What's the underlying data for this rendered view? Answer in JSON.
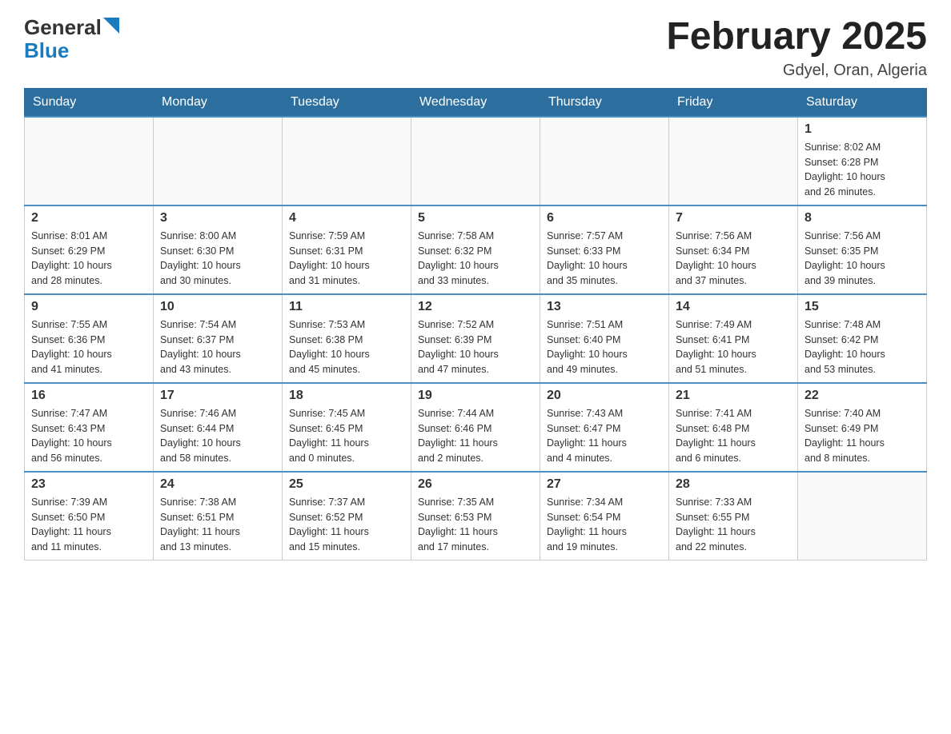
{
  "header": {
    "title": "February 2025",
    "subtitle": "Gdyel, Oran, Algeria",
    "logo_general": "General",
    "logo_blue": "Blue"
  },
  "days_of_week": [
    "Sunday",
    "Monday",
    "Tuesday",
    "Wednesday",
    "Thursday",
    "Friday",
    "Saturday"
  ],
  "weeks": [
    [
      {
        "day": "",
        "info": ""
      },
      {
        "day": "",
        "info": ""
      },
      {
        "day": "",
        "info": ""
      },
      {
        "day": "",
        "info": ""
      },
      {
        "day": "",
        "info": ""
      },
      {
        "day": "",
        "info": ""
      },
      {
        "day": "1",
        "info": "Sunrise: 8:02 AM\nSunset: 6:28 PM\nDaylight: 10 hours\nand 26 minutes."
      }
    ],
    [
      {
        "day": "2",
        "info": "Sunrise: 8:01 AM\nSunset: 6:29 PM\nDaylight: 10 hours\nand 28 minutes."
      },
      {
        "day": "3",
        "info": "Sunrise: 8:00 AM\nSunset: 6:30 PM\nDaylight: 10 hours\nand 30 minutes."
      },
      {
        "day": "4",
        "info": "Sunrise: 7:59 AM\nSunset: 6:31 PM\nDaylight: 10 hours\nand 31 minutes."
      },
      {
        "day": "5",
        "info": "Sunrise: 7:58 AM\nSunset: 6:32 PM\nDaylight: 10 hours\nand 33 minutes."
      },
      {
        "day": "6",
        "info": "Sunrise: 7:57 AM\nSunset: 6:33 PM\nDaylight: 10 hours\nand 35 minutes."
      },
      {
        "day": "7",
        "info": "Sunrise: 7:56 AM\nSunset: 6:34 PM\nDaylight: 10 hours\nand 37 minutes."
      },
      {
        "day": "8",
        "info": "Sunrise: 7:56 AM\nSunset: 6:35 PM\nDaylight: 10 hours\nand 39 minutes."
      }
    ],
    [
      {
        "day": "9",
        "info": "Sunrise: 7:55 AM\nSunset: 6:36 PM\nDaylight: 10 hours\nand 41 minutes."
      },
      {
        "day": "10",
        "info": "Sunrise: 7:54 AM\nSunset: 6:37 PM\nDaylight: 10 hours\nand 43 minutes."
      },
      {
        "day": "11",
        "info": "Sunrise: 7:53 AM\nSunset: 6:38 PM\nDaylight: 10 hours\nand 45 minutes."
      },
      {
        "day": "12",
        "info": "Sunrise: 7:52 AM\nSunset: 6:39 PM\nDaylight: 10 hours\nand 47 minutes."
      },
      {
        "day": "13",
        "info": "Sunrise: 7:51 AM\nSunset: 6:40 PM\nDaylight: 10 hours\nand 49 minutes."
      },
      {
        "day": "14",
        "info": "Sunrise: 7:49 AM\nSunset: 6:41 PM\nDaylight: 10 hours\nand 51 minutes."
      },
      {
        "day": "15",
        "info": "Sunrise: 7:48 AM\nSunset: 6:42 PM\nDaylight: 10 hours\nand 53 minutes."
      }
    ],
    [
      {
        "day": "16",
        "info": "Sunrise: 7:47 AM\nSunset: 6:43 PM\nDaylight: 10 hours\nand 56 minutes."
      },
      {
        "day": "17",
        "info": "Sunrise: 7:46 AM\nSunset: 6:44 PM\nDaylight: 10 hours\nand 58 minutes."
      },
      {
        "day": "18",
        "info": "Sunrise: 7:45 AM\nSunset: 6:45 PM\nDaylight: 11 hours\nand 0 minutes."
      },
      {
        "day": "19",
        "info": "Sunrise: 7:44 AM\nSunset: 6:46 PM\nDaylight: 11 hours\nand 2 minutes."
      },
      {
        "day": "20",
        "info": "Sunrise: 7:43 AM\nSunset: 6:47 PM\nDaylight: 11 hours\nand 4 minutes."
      },
      {
        "day": "21",
        "info": "Sunrise: 7:41 AM\nSunset: 6:48 PM\nDaylight: 11 hours\nand 6 minutes."
      },
      {
        "day": "22",
        "info": "Sunrise: 7:40 AM\nSunset: 6:49 PM\nDaylight: 11 hours\nand 8 minutes."
      }
    ],
    [
      {
        "day": "23",
        "info": "Sunrise: 7:39 AM\nSunset: 6:50 PM\nDaylight: 11 hours\nand 11 minutes."
      },
      {
        "day": "24",
        "info": "Sunrise: 7:38 AM\nSunset: 6:51 PM\nDaylight: 11 hours\nand 13 minutes."
      },
      {
        "day": "25",
        "info": "Sunrise: 7:37 AM\nSunset: 6:52 PM\nDaylight: 11 hours\nand 15 minutes."
      },
      {
        "day": "26",
        "info": "Sunrise: 7:35 AM\nSunset: 6:53 PM\nDaylight: 11 hours\nand 17 minutes."
      },
      {
        "day": "27",
        "info": "Sunrise: 7:34 AM\nSunset: 6:54 PM\nDaylight: 11 hours\nand 19 minutes."
      },
      {
        "day": "28",
        "info": "Sunrise: 7:33 AM\nSunset: 6:55 PM\nDaylight: 11 hours\nand 22 minutes."
      },
      {
        "day": "",
        "info": ""
      }
    ]
  ]
}
